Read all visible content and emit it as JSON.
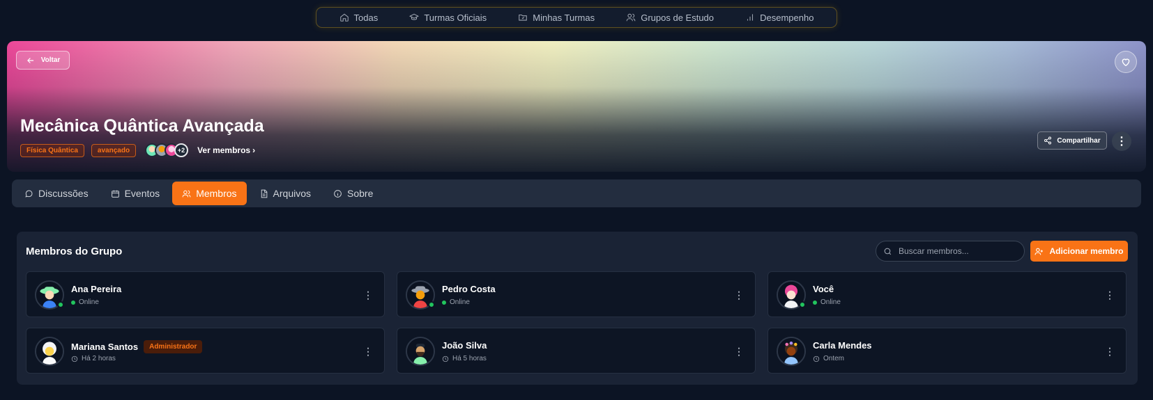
{
  "topnav": {
    "items": [
      {
        "label": "Todas",
        "icon": "home-icon"
      },
      {
        "label": "Turmas Oficiais",
        "icon": "graduation-cap-icon"
      },
      {
        "label": "Minhas Turmas",
        "icon": "folder-icon"
      },
      {
        "label": "Grupos de Estudo",
        "icon": "users-icon"
      },
      {
        "label": "Desempenho",
        "icon": "bar-chart-icon"
      }
    ]
  },
  "banner": {
    "back_label": "Voltar",
    "title": "Mecânica Quântica Avançada",
    "tags": [
      "Física Quântica",
      "avançado"
    ],
    "extra_members": "+2",
    "see_members_label": "Ver membros",
    "share_label": "Compartilhar"
  },
  "tabs": [
    {
      "label": "Discussões",
      "icon": "message-icon"
    },
    {
      "label": "Eventos",
      "icon": "calendar-icon"
    },
    {
      "label": "Membros",
      "icon": "users-icon",
      "active": true
    },
    {
      "label": "Arquivos",
      "icon": "file-icon"
    },
    {
      "label": "Sobre",
      "icon": "info-icon"
    }
  ],
  "members_panel": {
    "title": "Membros do Grupo",
    "search_placeholder": "Buscar membros...",
    "add_label": "Adicionar membro",
    "members": [
      {
        "name": "Ana Pereira",
        "status": "Online",
        "online": true,
        "badge": ""
      },
      {
        "name": "Pedro Costa",
        "status": "Online",
        "online": true,
        "badge": ""
      },
      {
        "name": "Você",
        "status": "Online",
        "online": true,
        "badge": ""
      },
      {
        "name": "Mariana Santos",
        "status": "Há 2 horas",
        "online": false,
        "badge": "Administrador"
      },
      {
        "name": "João Silva",
        "status": "Há 5 horas",
        "online": false,
        "badge": ""
      },
      {
        "name": "Carla Mendes",
        "status": "Ontem",
        "online": false,
        "badge": ""
      }
    ]
  },
  "colors": {
    "accent": "#f97316",
    "online": "#22c55e",
    "background": "#0c1424",
    "panel": "#1a2335"
  }
}
